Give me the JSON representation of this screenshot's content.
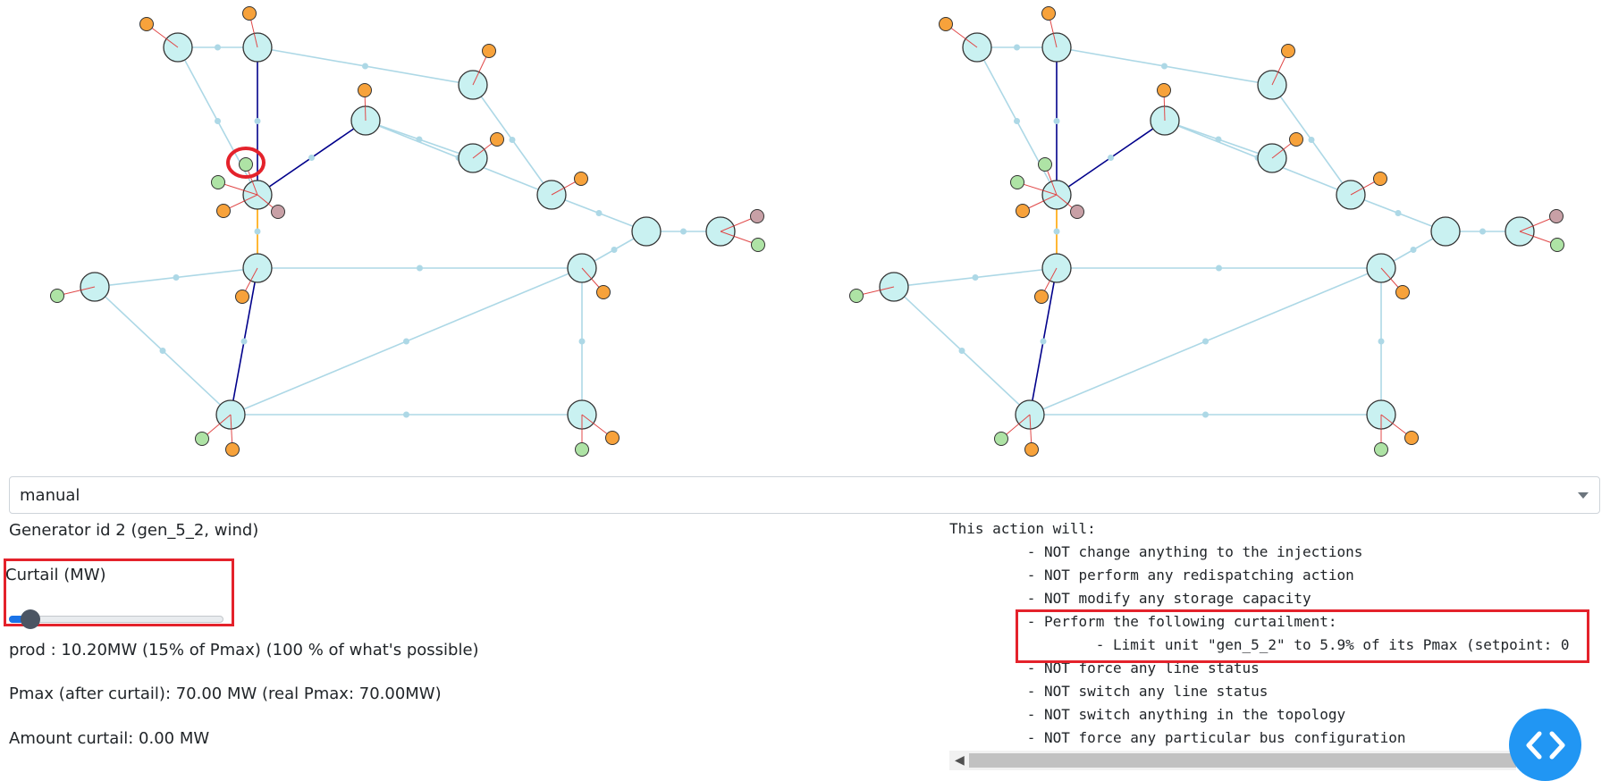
{
  "mode_dropdown": {
    "selected": "manual"
  },
  "generator": {
    "title": "Generator id 2 (gen_5_2, wind)",
    "curtail_label": "Curtail (MW)",
    "curtail_slider_fraction": 0.06,
    "prod_text": "prod : 10.20MW (15% of Pmax) (100 % of what's possible)",
    "pmax_text": "Pmax (after curtail): 70.00 MW (real Pmax: 70.00MW)",
    "amount_text": "Amount curtail: 0.00 MW"
  },
  "action_summary": {
    "text": "This action will:\n         - NOT change anything to the injections\n         - NOT perform any redispatching action\n         - NOT modify any storage capacity\n         - Perform the following curtailment:\n                 - Limit unit \"gen_5_2\" to 5.9% of its Pmax (setpoint: 0\n         - NOT force any line status\n         - NOT switch any line status\n         - NOT switch anything in the topology\n         - NOT force any particular bus configuration"
  },
  "colors": {
    "line": "#add8e6",
    "line_overloaded": "#00008b",
    "line_warning": "#ffa500",
    "substation": "#c9f1f1",
    "load": "#f7a23b",
    "generator": "#aee3a5",
    "storage": "#c8a0a6",
    "highlight": "#e4222b",
    "accent": "#2196f3"
  },
  "icons": {
    "code_button": "code-brackets-icon",
    "scroll_left": "chevron-left-icon"
  }
}
